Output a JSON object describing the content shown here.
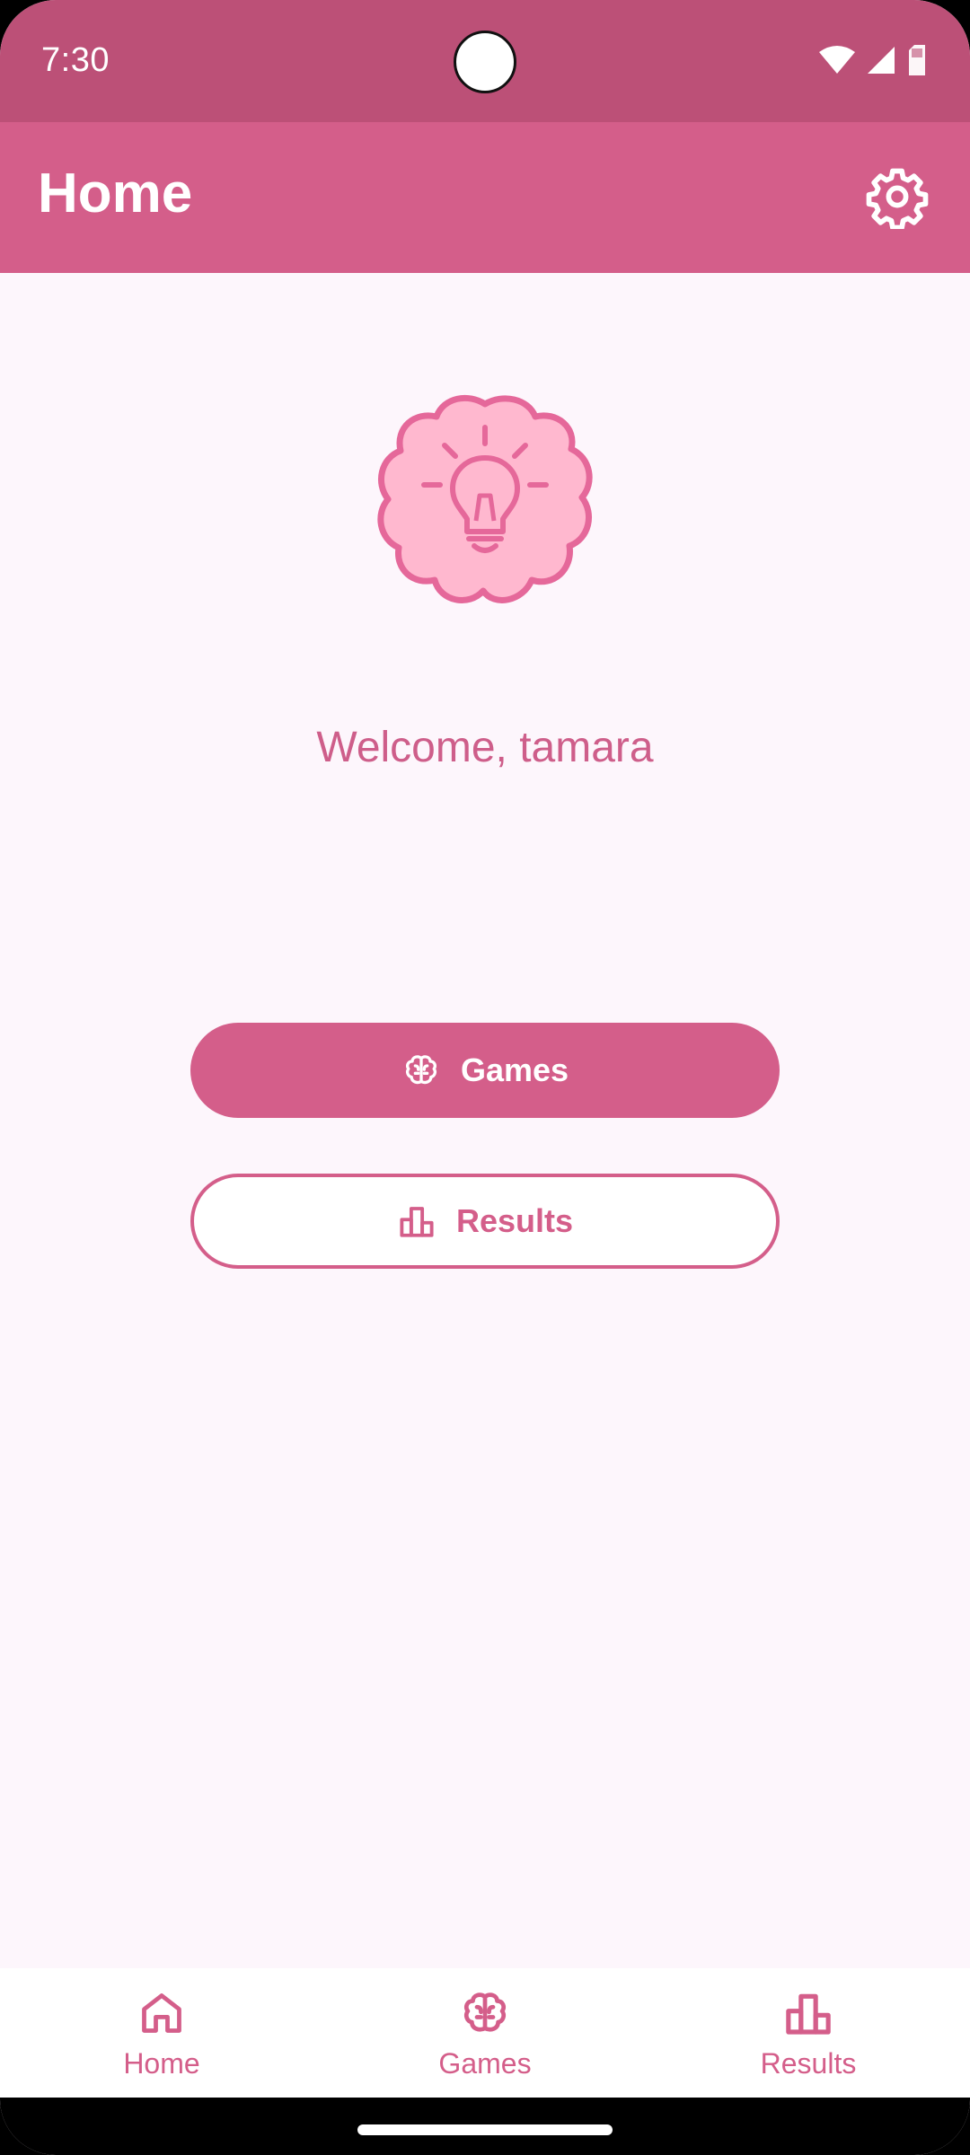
{
  "status_bar": {
    "time": "7:30"
  },
  "app_bar": {
    "title": "Home"
  },
  "welcome": {
    "text": "Welcome, tamara"
  },
  "buttons": {
    "games": "Games",
    "results": "Results"
  },
  "bottom_nav": {
    "items": [
      {
        "label": "Home",
        "icon": "home-icon"
      },
      {
        "label": "Games",
        "icon": "brain-icon"
      },
      {
        "label": "Results",
        "icon": "bar-chart-icon"
      }
    ]
  },
  "colors": {
    "status_bar": "#BC5077",
    "app_bar": "#D45E8A",
    "background": "#FDF6FC",
    "accent": "#D45E8A",
    "hero_fill": "#FFB8CF",
    "hero_stroke": "#E5689A"
  }
}
